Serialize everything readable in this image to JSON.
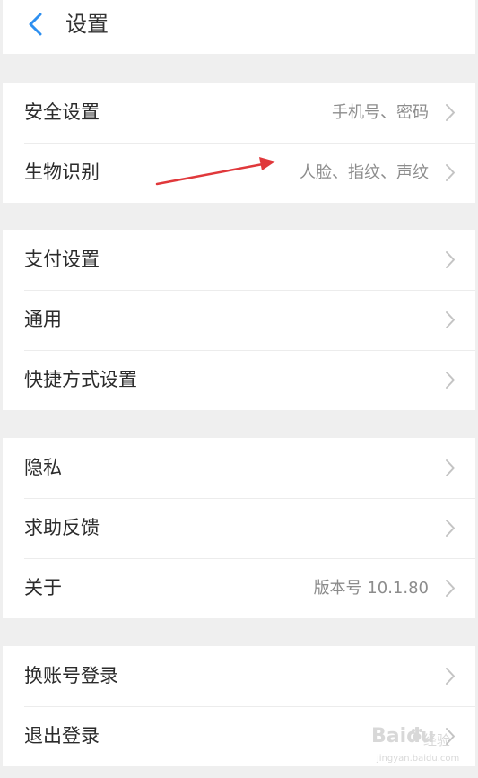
{
  "header": {
    "title": "设置"
  },
  "groups": [
    {
      "items": [
        {
          "label": "安全设置",
          "value": "手机号、密码"
        },
        {
          "label": "生物识别",
          "value": "人脸、指纹、声纹"
        }
      ]
    },
    {
      "items": [
        {
          "label": "支付设置",
          "value": ""
        },
        {
          "label": "通用",
          "value": ""
        },
        {
          "label": "快捷方式设置",
          "value": ""
        }
      ]
    },
    {
      "items": [
        {
          "label": "隐私",
          "value": ""
        },
        {
          "label": "求助反馈",
          "value": ""
        },
        {
          "label": "关于",
          "value": "版本号 10.1.80"
        }
      ]
    },
    {
      "items": [
        {
          "label": "换账号登录",
          "value": ""
        },
        {
          "label": "退出登录",
          "value": ""
        }
      ]
    }
  ],
  "watermark": {
    "brand": "Baidu",
    "cn": "经验",
    "url": "jingyan.baidu.com"
  },
  "colors": {
    "background": "#efefef",
    "accent_back": "#2d8ff0",
    "annotation_arrow": "#e0383b",
    "chevron": "#c4c4c4"
  },
  "icons": {
    "back": "chevron-left-icon",
    "row_arrow": "chevron-right-icon"
  }
}
